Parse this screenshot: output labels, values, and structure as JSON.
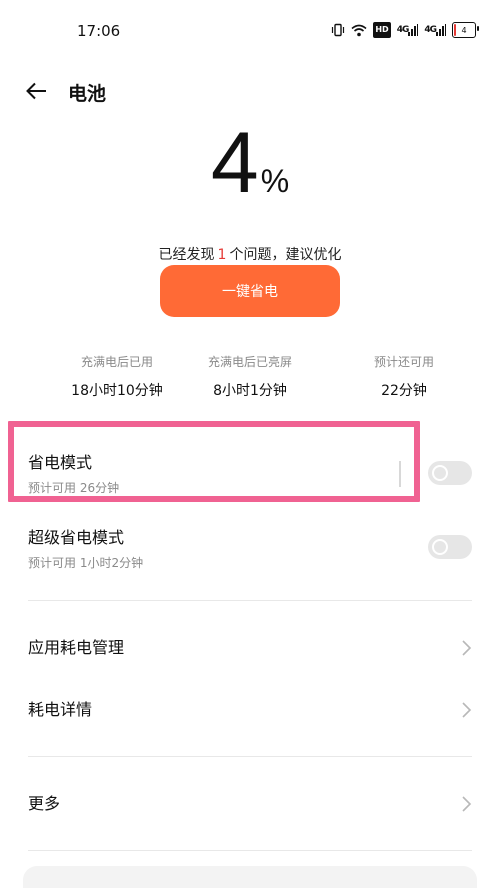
{
  "status_bar": {
    "time": "17:06",
    "hd_label": "HD",
    "signal1_label": "4G",
    "signal2_label": "4G",
    "battery_level": "4"
  },
  "header": {
    "title": "电池"
  },
  "battery": {
    "percent_value": "4",
    "percent_sign": "%"
  },
  "issue": {
    "prefix": "已经发现",
    "count": "1",
    "suffix": "个问题，建议优化"
  },
  "optimize_button": {
    "label": "一键省电"
  },
  "stats": [
    {
      "label": "充满电后已用",
      "value": "18小时10分钟"
    },
    {
      "label": "充满电后已亮屏",
      "value": "8小时1分钟"
    },
    {
      "label": "预计还可用",
      "value": "22分钟"
    }
  ],
  "modes": {
    "power_saving": {
      "title": "省电模式",
      "subtitle": "预计可用 26分钟",
      "enabled": false
    },
    "super_power_saving": {
      "title": "超级省电模式",
      "subtitle": "预计可用 1小时2分钟",
      "enabled": false
    }
  },
  "menu": {
    "app_power_management": "应用耗电管理",
    "power_details": "耗电详情",
    "more": "更多"
  },
  "colors": {
    "accent": "#ff6a36",
    "issue_count": "#e53935",
    "highlight": "#f06292"
  }
}
